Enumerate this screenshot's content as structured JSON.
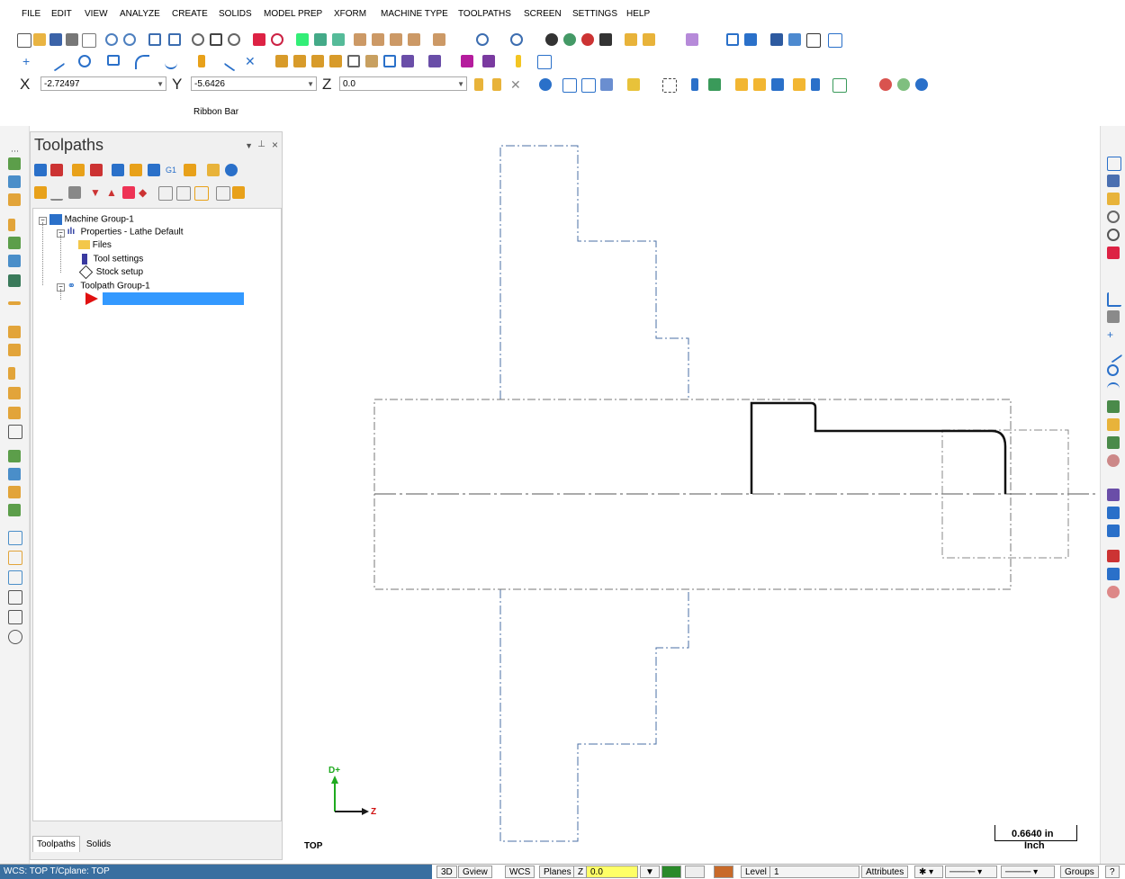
{
  "menu": [
    "FILE",
    "EDIT",
    "VIEW",
    "ANALYZE",
    "CREATE",
    "SOLIDS",
    "MODEL PREP",
    "XFORM",
    "MACHINE TYPE",
    "TOOLPATHS",
    "SCREEN",
    "SETTINGS",
    "HELP"
  ],
  "coords": {
    "x_label": "X",
    "x_value": "-2.72497",
    "y_label": "Y",
    "y_value": "-5.6426",
    "z_label": "Z",
    "z_value": "0.0"
  },
  "ribbon_bar": "Ribbon Bar",
  "panel": {
    "title": "Toolpaths",
    "tree": {
      "machine_group": "Machine Group-1",
      "properties": "Properties - Lathe Default",
      "files": "Files",
      "tool_settings": "Tool settings",
      "stock_setup": "Stock setup",
      "toolpath_group": "Toolpath Group-1",
      "new_operation": ""
    },
    "tabs": [
      "Toolpaths",
      "Solids"
    ]
  },
  "viewport": {
    "axis_d": "D+",
    "axis_z": "Z",
    "view_name": "TOP",
    "scale_value": "0.6640 in",
    "scale_unit": "Inch"
  },
  "status": {
    "wcs": "WCS: TOP  T/Cplane: TOP",
    "btn_3d": "3D",
    "gview": "Gview",
    "wcs_btn": "WCS",
    "planes": "Planes",
    "z_label": "Z",
    "z_value": "0.0",
    "level_label": "Level",
    "level_value": "1",
    "attributes": "Attributes",
    "groups": "Groups",
    "help": "?"
  },
  "colors": {
    "accent_blue": "#3399ff",
    "status_blue": "#3a6fa0",
    "z_highlight": "#ffff66"
  }
}
